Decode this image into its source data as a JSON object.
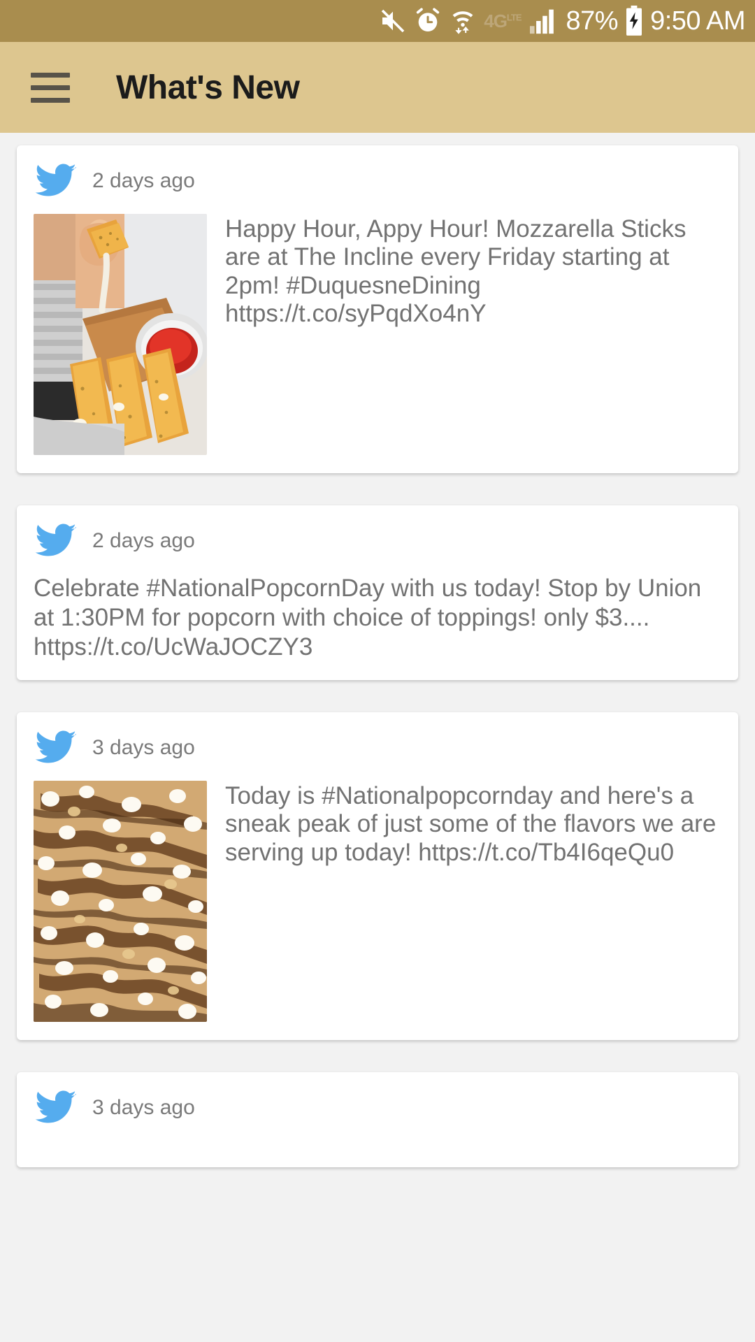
{
  "status_bar": {
    "icons": [
      "mute-icon",
      "alarm-icon",
      "wifi-icon",
      "4g-lte-icon",
      "signal-icon"
    ],
    "network_label": "4G",
    "network_sub": "LTE",
    "battery_percent": "87%",
    "battery_state": "charging",
    "time": "9:50 AM",
    "background_color": "#a98d4e"
  },
  "app_bar": {
    "menu_label": "menu",
    "title": "What's New",
    "background_color": "#ddc68f",
    "title_color": "#1b1b1b"
  },
  "feed": {
    "source_icon": "twitter-bird-icon",
    "accent_color": "#55acee",
    "cards": [
      {
        "timestamp": "2 days ago",
        "has_image": true,
        "image_alt": "mozzarella sticks with marinara dipping sauce",
        "text": "Happy Hour, Appy Hour! Mozzarella Sticks are at The Incline every Friday starting at 2pm! #DuquesneDining https://t.co/syPqdXo4nY"
      },
      {
        "timestamp": "2 days ago",
        "has_image": false,
        "text": "Celebrate #NationalPopcornDay with us today! Stop by Union at 1:30PM for popcorn with choice of toppings! only $3.... https://t.co/UcWaJOCZY3"
      },
      {
        "timestamp": "3 days ago",
        "has_image": true,
        "image_alt": "chocolate drizzled popcorn with marshmallows",
        "text": "Today is #Nationalpopcornday and here's a sneak peak of just some of the flavors we are serving up today! https://t.co/Tb4I6qeQu0"
      },
      {
        "timestamp": "3 days ago",
        "has_image": false,
        "text": ""
      }
    ]
  }
}
